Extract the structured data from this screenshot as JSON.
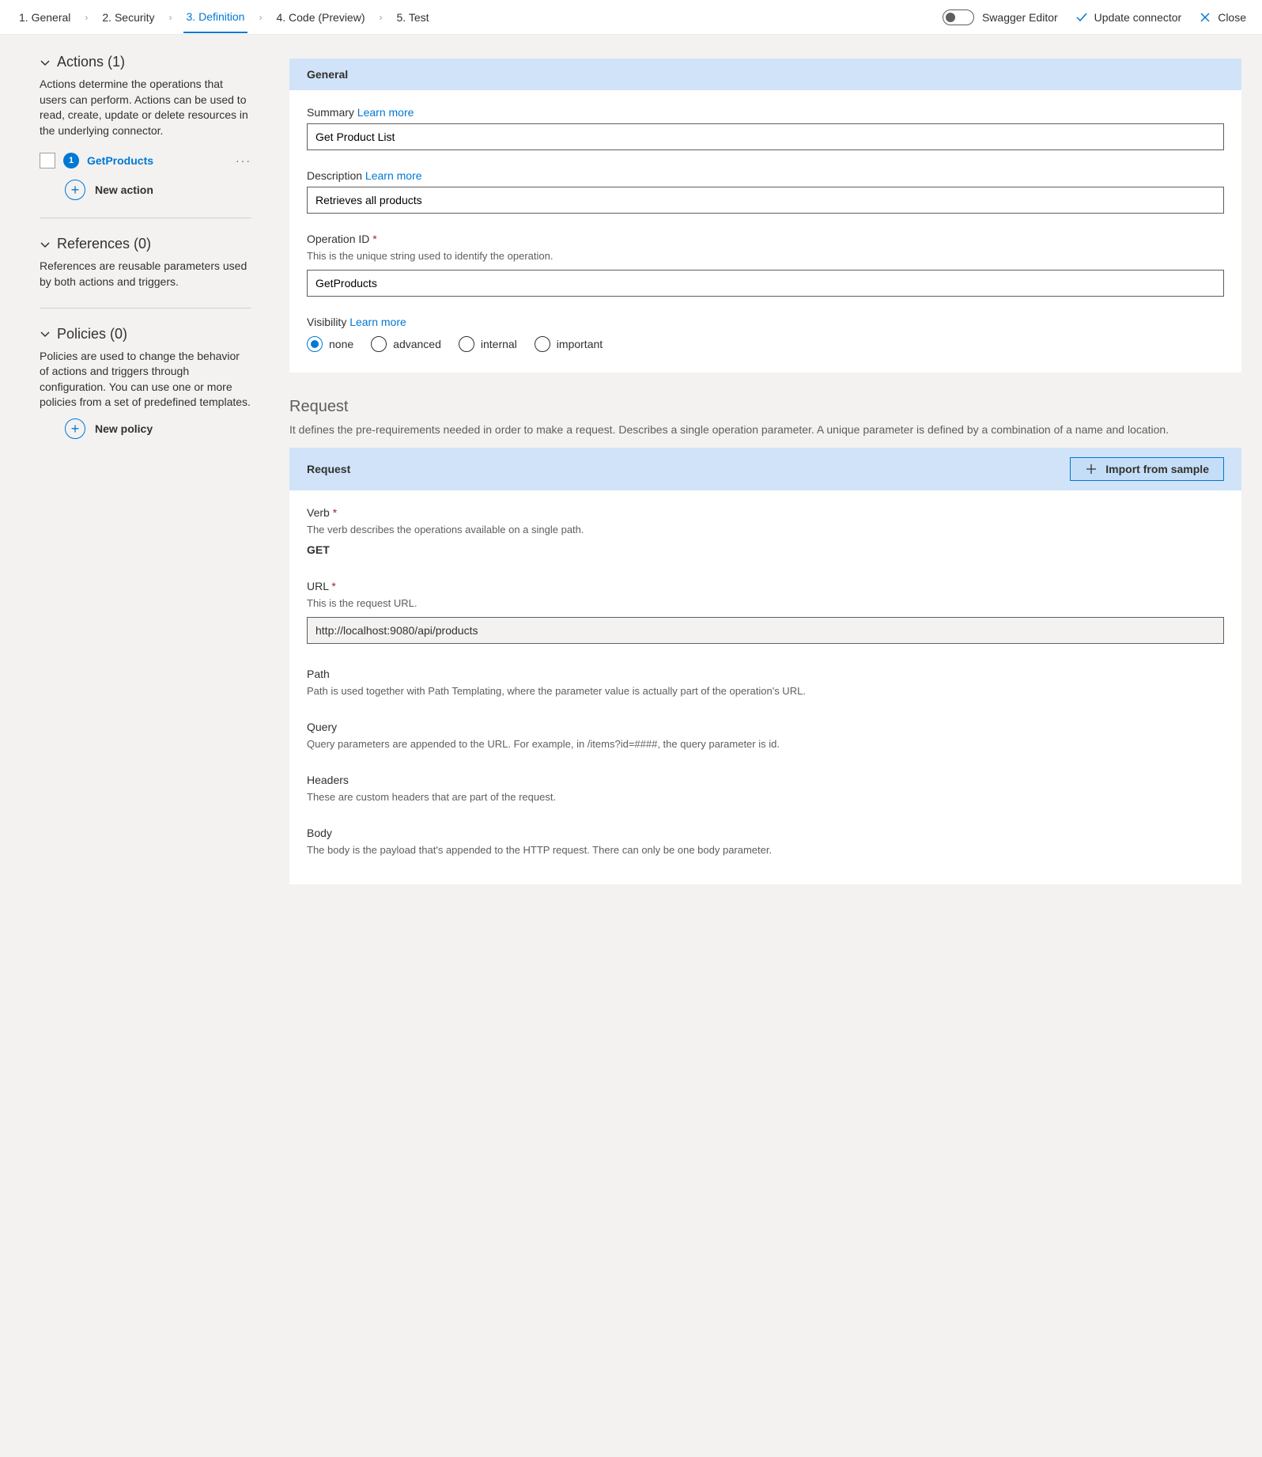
{
  "topbar": {
    "steps": [
      "1. General",
      "2. Security",
      "3. Definition",
      "4. Code (Preview)",
      "5. Test"
    ],
    "active_step": 2,
    "swagger_label": "Swagger Editor",
    "update_label": "Update connector",
    "close_label": "Close"
  },
  "sidebar": {
    "actions": {
      "title": "Actions (1)",
      "desc": "Actions determine the operations that users can perform. Actions can be used to read, create, update or delete resources in the underlying connector.",
      "items": [
        {
          "badge": "1",
          "name": "GetProducts"
        }
      ],
      "new_label": "New action"
    },
    "references": {
      "title": "References (0)",
      "desc": "References are reusable parameters used by both actions and triggers."
    },
    "policies": {
      "title": "Policies (0)",
      "desc": "Policies are used to change the behavior of actions and triggers through configuration. You can use one or more policies from a set of predefined templates.",
      "new_label": "New policy"
    }
  },
  "general": {
    "header": "General",
    "summary_label": "Summary",
    "learn_more": "Learn more",
    "summary_value": "Get Product List",
    "description_label": "Description",
    "description_value": "Retrieves all products",
    "opid_label": "Operation ID",
    "opid_help": "This is the unique string used to identify the operation.",
    "opid_value": "GetProducts",
    "visibility_label": "Visibility",
    "visibility_options": [
      "none",
      "advanced",
      "internal",
      "important"
    ],
    "visibility_selected": "none"
  },
  "request": {
    "title": "Request",
    "desc": "It defines the pre-requirements needed in order to make a request. Describes a single operation parameter. A unique parameter is defined by a combination of a name and location.",
    "header": "Request",
    "import_label": "Import from sample",
    "verb_label": "Verb",
    "verb_help": "The verb describes the operations available on a single path.",
    "verb_value": "GET",
    "url_label": "URL",
    "url_help": "This is the request URL.",
    "url_value": "http://localhost:9080/api/products",
    "path_label": "Path",
    "path_help": "Path is used together with Path Templating, where the parameter value is actually part of the operation's URL.",
    "query_label": "Query",
    "query_help": "Query parameters are appended to the URL. For example, in /items?id=####, the query parameter is id.",
    "headers_label": "Headers",
    "headers_help": "These are custom headers that are part of the request.",
    "body_label": "Body",
    "body_help": "The body is the payload that's appended to the HTTP request. There can only be one body parameter."
  }
}
